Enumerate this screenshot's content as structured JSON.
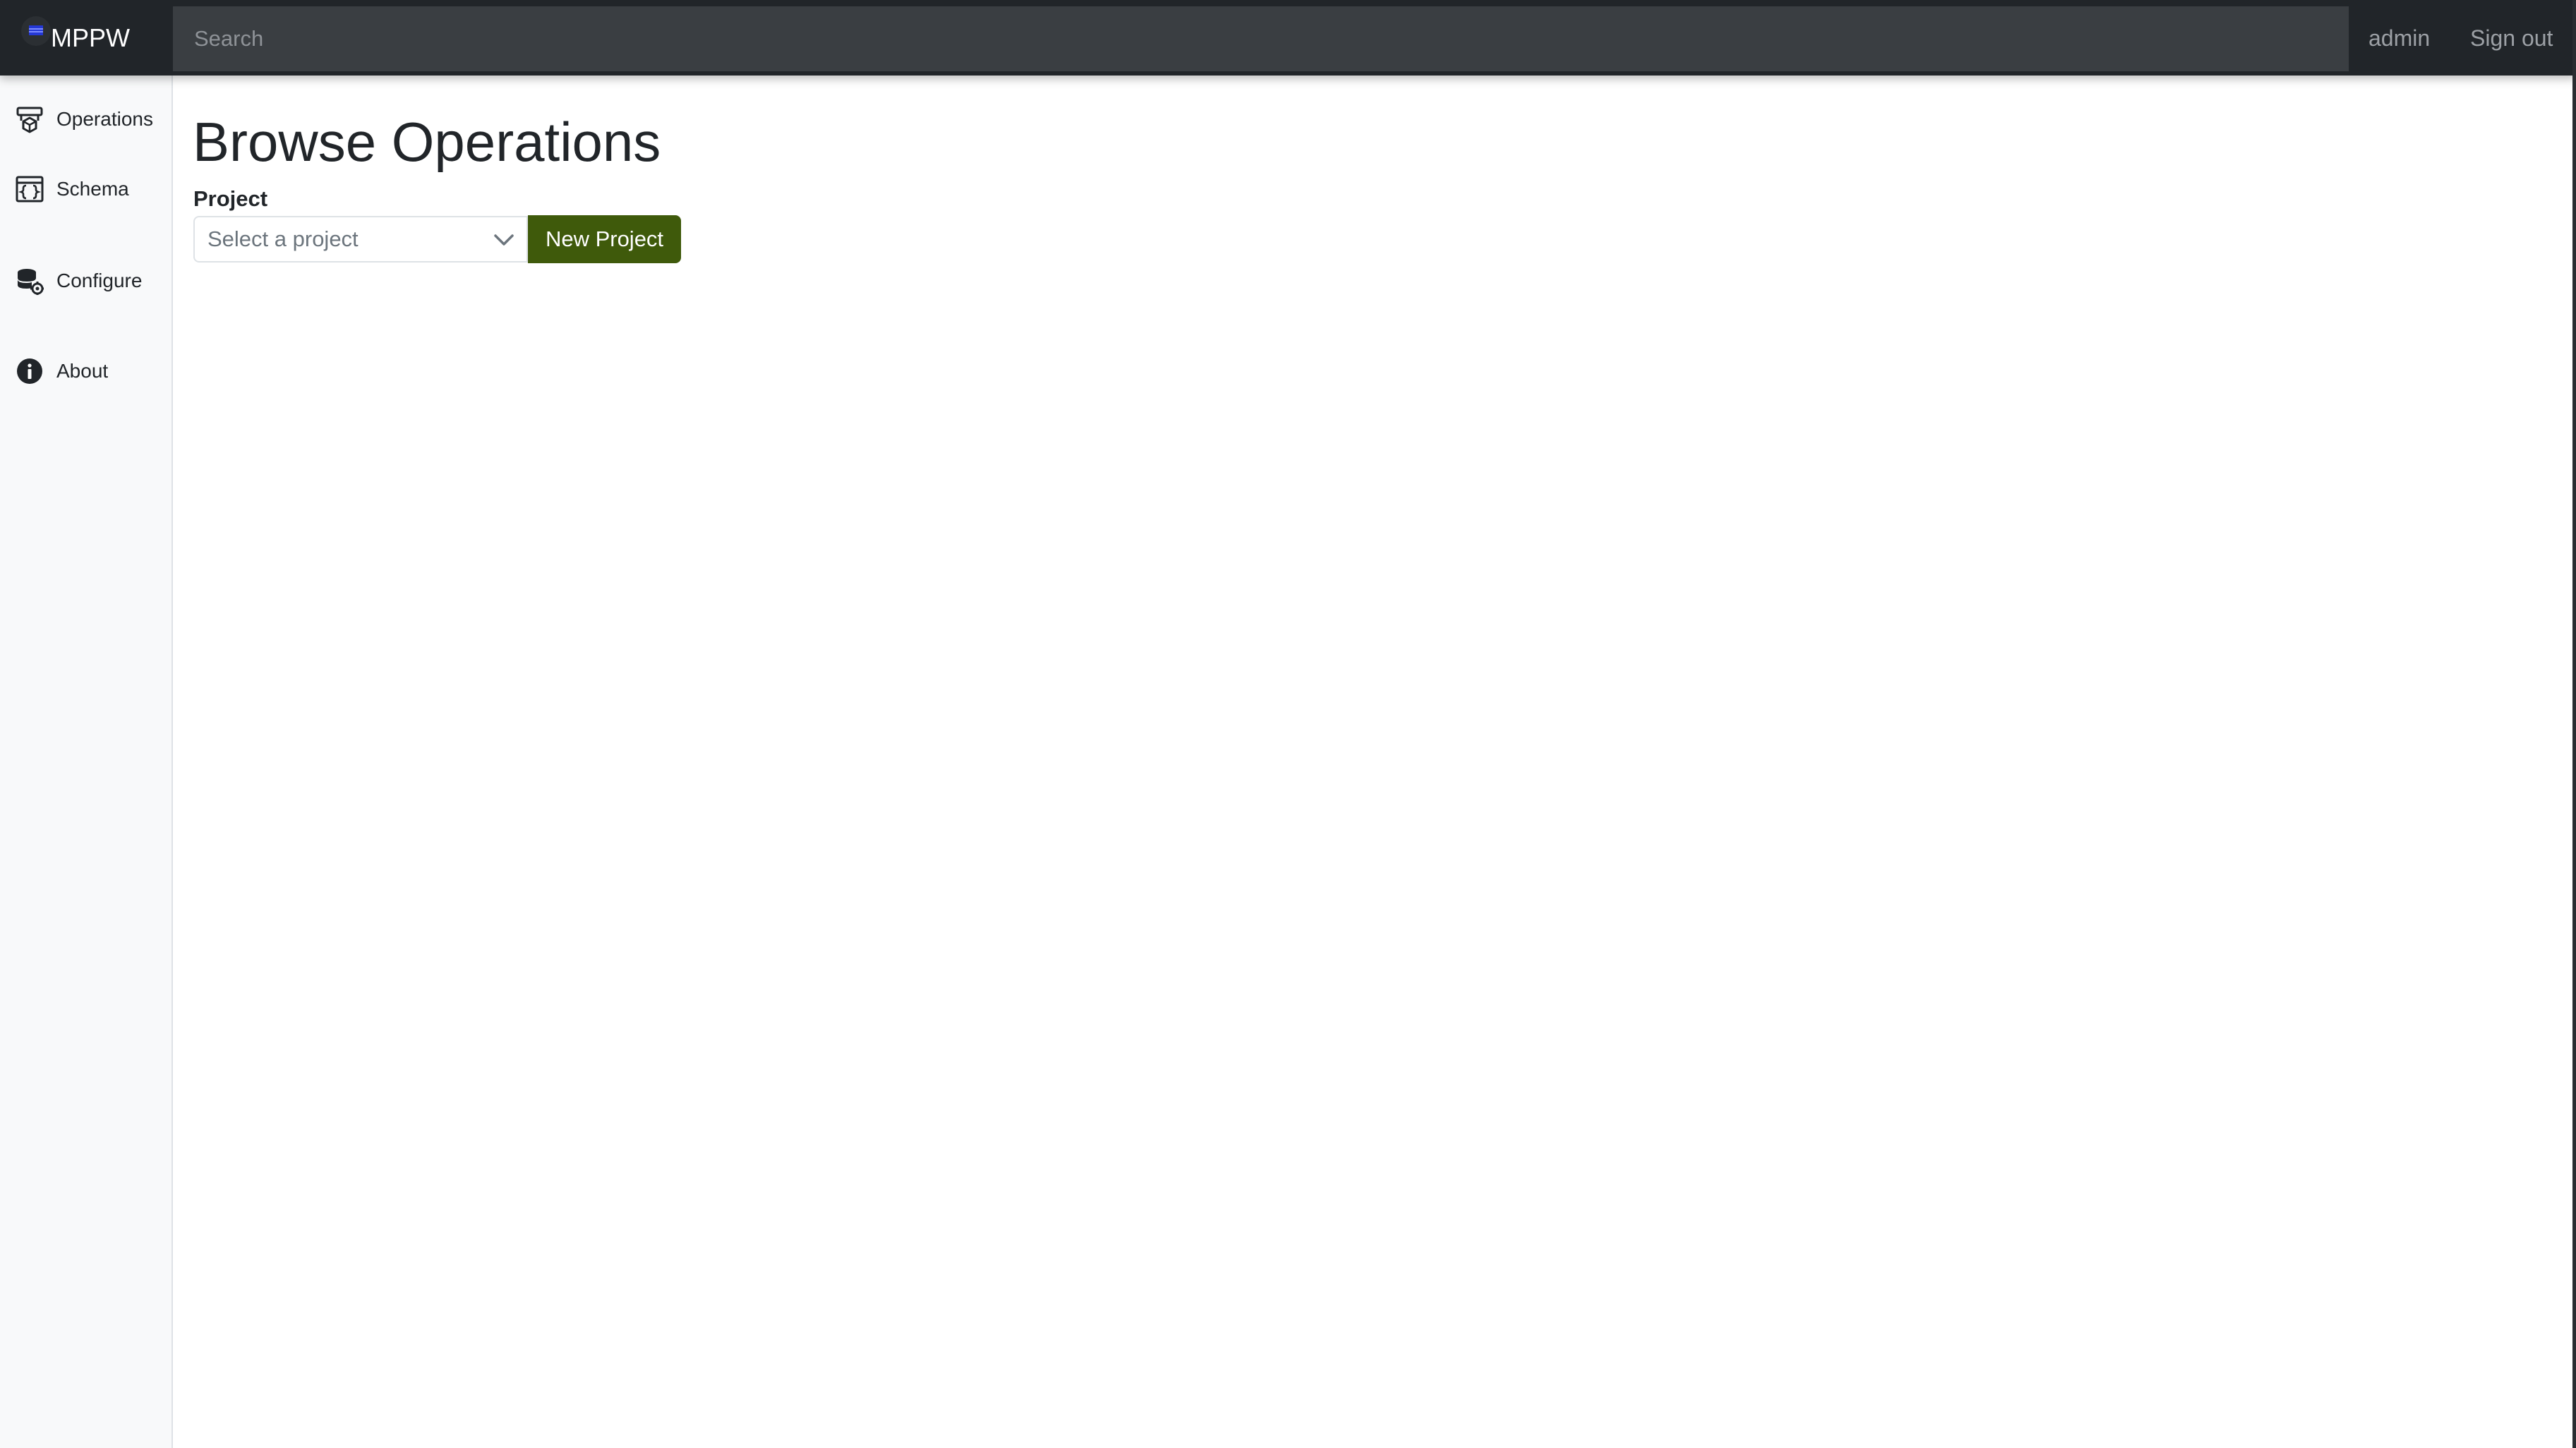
{
  "app": {
    "brand": "MPPW"
  },
  "header": {
    "search_placeholder": "Search",
    "user": "admin",
    "sign_out": "Sign out"
  },
  "sidebar": {
    "items": [
      {
        "label": "Operations",
        "icon": "operations-icon"
      },
      {
        "label": "Schema",
        "icon": "schema-icon"
      },
      {
        "label": "Configure",
        "icon": "configure-icon"
      },
      {
        "label": "About",
        "icon": "info-icon"
      }
    ]
  },
  "main": {
    "title": "Browse Operations",
    "project_label": "Project",
    "project_select_placeholder": "Select a project",
    "new_project_button": "New Project"
  },
  "colors": {
    "navbar": "#212529",
    "accent_button": "#3f5a0b",
    "sidebar_bg": "#f8f9fa"
  }
}
